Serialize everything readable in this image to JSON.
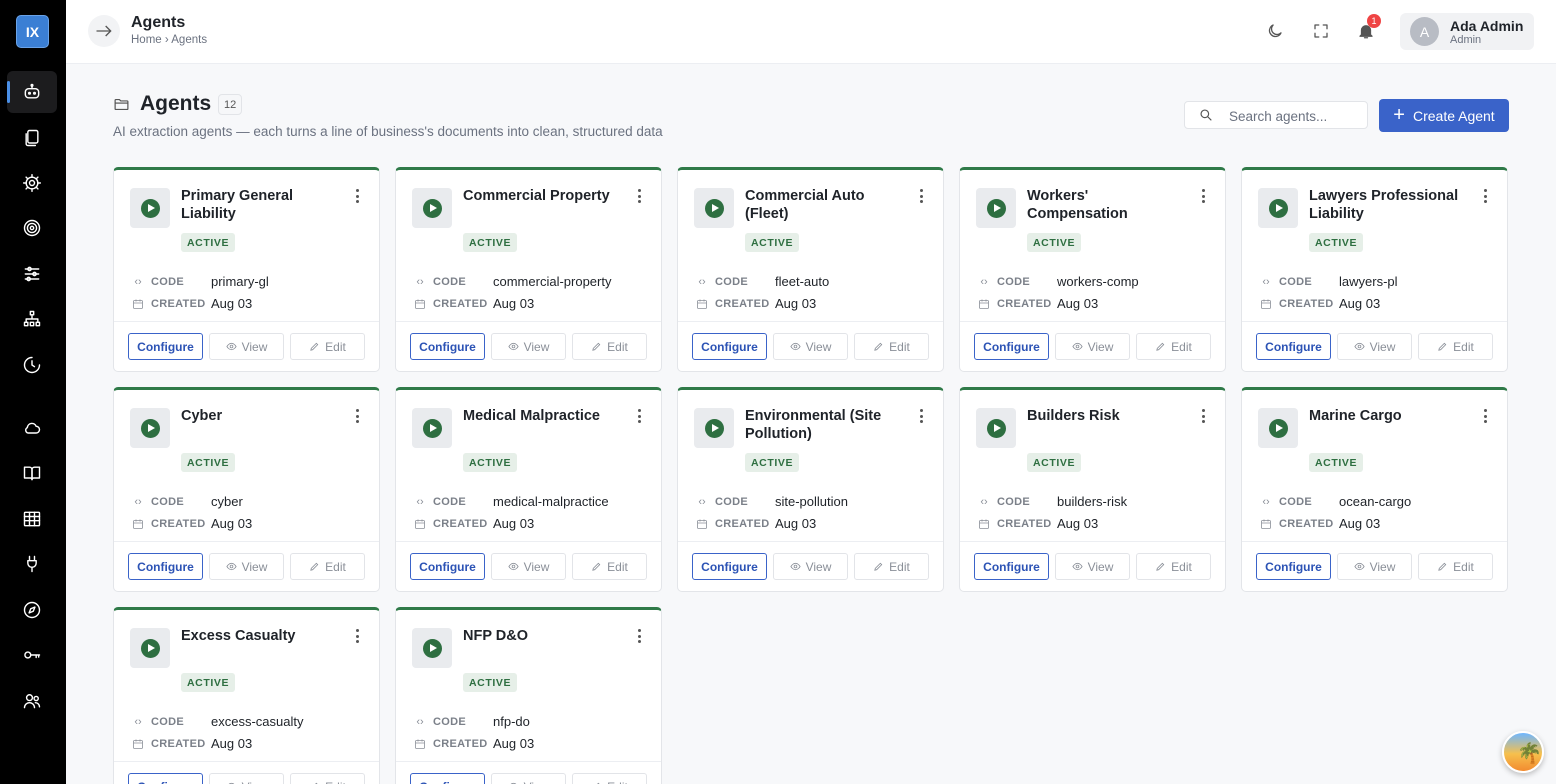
{
  "sidebar": {
    "logo": "IX",
    "items": [
      {
        "name": "agents",
        "icon": "robot-icon",
        "active": true
      },
      {
        "name": "documents",
        "icon": "documents-icon"
      },
      {
        "name": "settings",
        "icon": "gear-icon"
      },
      {
        "name": "targets",
        "icon": "target-icon"
      },
      {
        "name": "filters",
        "icon": "sliders-icon"
      },
      {
        "name": "hierarchy",
        "icon": "hierarchy-icon"
      },
      {
        "name": "history",
        "icon": "history-icon"
      },
      {
        "name": "cloud",
        "icon": "cloud-icon"
      },
      {
        "name": "library",
        "icon": "book-icon"
      },
      {
        "name": "tables",
        "icon": "table-icon"
      },
      {
        "name": "integrations",
        "icon": "plug-icon"
      },
      {
        "name": "explore",
        "icon": "compass-icon"
      },
      {
        "name": "keys",
        "icon": "key-icon"
      },
      {
        "name": "users",
        "icon": "users-icon"
      }
    ]
  },
  "topbar": {
    "title": "Agents",
    "breadcrumb": "Home › Agents",
    "notification_count": "1",
    "user": {
      "initial": "A",
      "name": "Ada Admin",
      "role": "Admin"
    }
  },
  "header": {
    "title": "Agents",
    "count": "12",
    "subtitle": "AI extraction agents — each turns a line of business's documents into clean, structured data",
    "search_placeholder": "Search agents...",
    "create_label": "Create Agent"
  },
  "labels": {
    "code": "CODE",
    "created": "CREATED",
    "configure": "Configure",
    "view": "View",
    "edit": "Edit"
  },
  "colors": {
    "accent": "#3a63c9",
    "active_green": "#2e6f41",
    "sidebar": "#000000"
  },
  "agents": [
    {
      "title": "Primary General Liability",
      "status": "ACTIVE",
      "code": "primary-gl",
      "created": "Aug 03"
    },
    {
      "title": "Commercial Property",
      "status": "ACTIVE",
      "code": "commercial-property",
      "created": "Aug 03"
    },
    {
      "title": "Commercial Auto (Fleet)",
      "status": "ACTIVE",
      "code": "fleet-auto",
      "created": "Aug 03"
    },
    {
      "title": "Workers' Compensation",
      "status": "ACTIVE",
      "code": "workers-comp",
      "created": "Aug 03"
    },
    {
      "title": "Lawyers Professional Liability",
      "status": "ACTIVE",
      "code": "lawyers-pl",
      "created": "Aug 03"
    },
    {
      "title": "Cyber",
      "status": "ACTIVE",
      "code": "cyber",
      "created": "Aug 03"
    },
    {
      "title": "Medical Malpractice",
      "status": "ACTIVE",
      "code": "medical-malpractice",
      "created": "Aug 03"
    },
    {
      "title": "Environmental (Site Pollution)",
      "status": "ACTIVE",
      "code": "site-pollution",
      "created": "Aug 03"
    },
    {
      "title": "Builders Risk",
      "status": "ACTIVE",
      "code": "builders-risk",
      "created": "Aug 03"
    },
    {
      "title": "Marine Cargo",
      "status": "ACTIVE",
      "code": "ocean-cargo",
      "created": "Aug 03"
    },
    {
      "title": "Excess Casualty",
      "status": "ACTIVE",
      "code": "excess-casualty",
      "created": "Aug 03"
    },
    {
      "title": "NFP D&O",
      "status": "ACTIVE",
      "code": "nfp-do",
      "created": "Aug 03"
    }
  ]
}
